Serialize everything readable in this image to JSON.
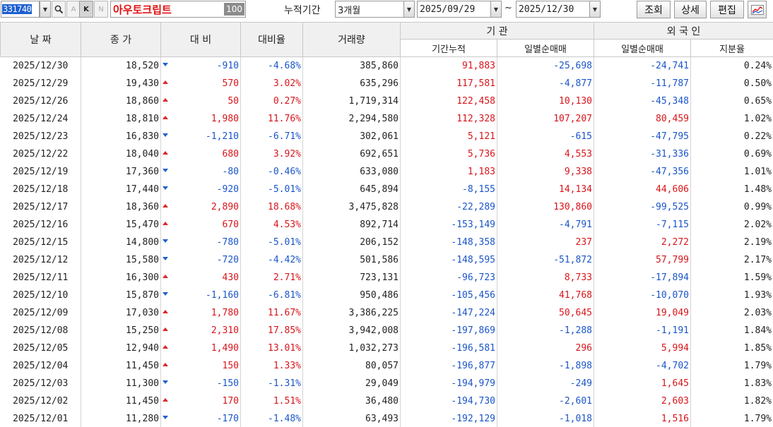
{
  "toolbar": {
    "stock_code": "331740",
    "btn_a": "A",
    "btn_k": "K",
    "btn_n": "N",
    "stock_name": "아우토크립트",
    "name_num": "100",
    "period_label": "누적기간",
    "period_value": "3개월",
    "date_from": "2025/09/29",
    "tilde": "~",
    "date_to": "2025/12/30",
    "btn_query": "조회",
    "btn_detail": "상세",
    "btn_edit": "편집"
  },
  "headers": {
    "date": "날 짜",
    "close": "종 가",
    "change": "대 비",
    "change_rate": "대비율",
    "volume": "거래량",
    "institution": "기 관",
    "inst_cumulative": "기간누적",
    "inst_daily": "일별순매매",
    "foreign": "외 국 인",
    "foreign_daily": "일별순매매",
    "foreign_share": "지분율"
  },
  "colors": {
    "up": "#d8141a",
    "down": "#1a55c9",
    "header_bg": "#f0f0f0",
    "code_highlight": "#1c5fd2"
  },
  "rows": [
    {
      "date": "2025/12/30",
      "close": "18,520",
      "dir": "down",
      "change": "-910",
      "rate": "-4.68%",
      "volume": "385,860",
      "inst_cum": "91,883",
      "inst_daily": "-25,698",
      "frgn_daily": "-24,741",
      "share": "0.24%"
    },
    {
      "date": "2025/12/29",
      "close": "19,430",
      "dir": "up",
      "change": "570",
      "rate": "3.02%",
      "volume": "635,296",
      "inst_cum": "117,581",
      "inst_daily": "-4,877",
      "frgn_daily": "-11,787",
      "share": "0.50%"
    },
    {
      "date": "2025/12/26",
      "close": "18,860",
      "dir": "up",
      "change": "50",
      "rate": "0.27%",
      "volume": "1,719,314",
      "inst_cum": "122,458",
      "inst_daily": "10,130",
      "frgn_daily": "-45,348",
      "share": "0.65%"
    },
    {
      "date": "2025/12/24",
      "close": "18,810",
      "dir": "up",
      "change": "1,980",
      "rate": "11.76%",
      "volume": "2,294,580",
      "inst_cum": "112,328",
      "inst_daily": "107,207",
      "frgn_daily": "80,459",
      "share": "1.02%"
    },
    {
      "date": "2025/12/23",
      "close": "16,830",
      "dir": "down",
      "change": "-1,210",
      "rate": "-6.71%",
      "volume": "302,061",
      "inst_cum": "5,121",
      "inst_daily": "-615",
      "frgn_daily": "-47,795",
      "share": "0.22%"
    },
    {
      "date": "2025/12/22",
      "close": "18,040",
      "dir": "up",
      "change": "680",
      "rate": "3.92%",
      "volume": "692,651",
      "inst_cum": "5,736",
      "inst_daily": "4,553",
      "frgn_daily": "-31,336",
      "share": "0.69%"
    },
    {
      "date": "2025/12/19",
      "close": "17,360",
      "dir": "down",
      "change": "-80",
      "rate": "-0.46%",
      "volume": "633,080",
      "inst_cum": "1,183",
      "inst_daily": "9,338",
      "frgn_daily": "-47,356",
      "share": "1.01%"
    },
    {
      "date": "2025/12/18",
      "close": "17,440",
      "dir": "down",
      "change": "-920",
      "rate": "-5.01%",
      "volume": "645,894",
      "inst_cum": "-8,155",
      "inst_daily": "14,134",
      "frgn_daily": "44,606",
      "share": "1.48%"
    },
    {
      "date": "2025/12/17",
      "close": "18,360",
      "dir": "up",
      "change": "2,890",
      "rate": "18.68%",
      "volume": "3,475,828",
      "inst_cum": "-22,289",
      "inst_daily": "130,860",
      "frgn_daily": "-99,525",
      "share": "0.99%"
    },
    {
      "date": "2025/12/16",
      "close": "15,470",
      "dir": "up",
      "change": "670",
      "rate": "4.53%",
      "volume": "892,714",
      "inst_cum": "-153,149",
      "inst_daily": "-4,791",
      "frgn_daily": "-7,115",
      "share": "2.02%"
    },
    {
      "date": "2025/12/15",
      "close": "14,800",
      "dir": "down",
      "change": "-780",
      "rate": "-5.01%",
      "volume": "206,152",
      "inst_cum": "-148,358",
      "inst_daily": "237",
      "frgn_daily": "2,272",
      "share": "2.19%"
    },
    {
      "date": "2025/12/12",
      "close": "15,580",
      "dir": "down",
      "change": "-720",
      "rate": "-4.42%",
      "volume": "501,586",
      "inst_cum": "-148,595",
      "inst_daily": "-51,872",
      "frgn_daily": "57,799",
      "share": "2.17%"
    },
    {
      "date": "2025/12/11",
      "close": "16,300",
      "dir": "up",
      "change": "430",
      "rate": "2.71%",
      "volume": "723,131",
      "inst_cum": "-96,723",
      "inst_daily": "8,733",
      "frgn_daily": "-17,894",
      "share": "1.59%"
    },
    {
      "date": "2025/12/10",
      "close": "15,870",
      "dir": "down",
      "change": "-1,160",
      "rate": "-6.81%",
      "volume": "950,486",
      "inst_cum": "-105,456",
      "inst_daily": "41,768",
      "frgn_daily": "-10,070",
      "share": "1.93%"
    },
    {
      "date": "2025/12/09",
      "close": "17,030",
      "dir": "up",
      "change": "1,780",
      "rate": "11.67%",
      "volume": "3,386,225",
      "inst_cum": "-147,224",
      "inst_daily": "50,645",
      "frgn_daily": "19,049",
      "share": "2.03%"
    },
    {
      "date": "2025/12/08",
      "close": "15,250",
      "dir": "up",
      "change": "2,310",
      "rate": "17.85%",
      "volume": "3,942,008",
      "inst_cum": "-197,869",
      "inst_daily": "-1,288",
      "frgn_daily": "-1,191",
      "share": "1.84%"
    },
    {
      "date": "2025/12/05",
      "close": "12,940",
      "dir": "up",
      "change": "1,490",
      "rate": "13.01%",
      "volume": "1,032,273",
      "inst_cum": "-196,581",
      "inst_daily": "296",
      "frgn_daily": "5,994",
      "share": "1.85%"
    },
    {
      "date": "2025/12/04",
      "close": "11,450",
      "dir": "up",
      "change": "150",
      "rate": "1.33%",
      "volume": "80,057",
      "inst_cum": "-196,877",
      "inst_daily": "-1,898",
      "frgn_daily": "-4,702",
      "share": "1.79%"
    },
    {
      "date": "2025/12/03",
      "close": "11,300",
      "dir": "down",
      "change": "-150",
      "rate": "-1.31%",
      "volume": "29,049",
      "inst_cum": "-194,979",
      "inst_daily": "-249",
      "frgn_daily": "1,645",
      "share": "1.83%"
    },
    {
      "date": "2025/12/02",
      "close": "11,450",
      "dir": "up",
      "change": "170",
      "rate": "1.51%",
      "volume": "36,480",
      "inst_cum": "-194,730",
      "inst_daily": "-2,601",
      "frgn_daily": "2,603",
      "share": "1.82%"
    },
    {
      "date": "2025/12/01",
      "close": "11,280",
      "dir": "down",
      "change": "-170",
      "rate": "-1.48%",
      "volume": "63,493",
      "inst_cum": "-192,129",
      "inst_daily": "-1,018",
      "frgn_daily": "1,516",
      "share": "1.79%"
    }
  ]
}
